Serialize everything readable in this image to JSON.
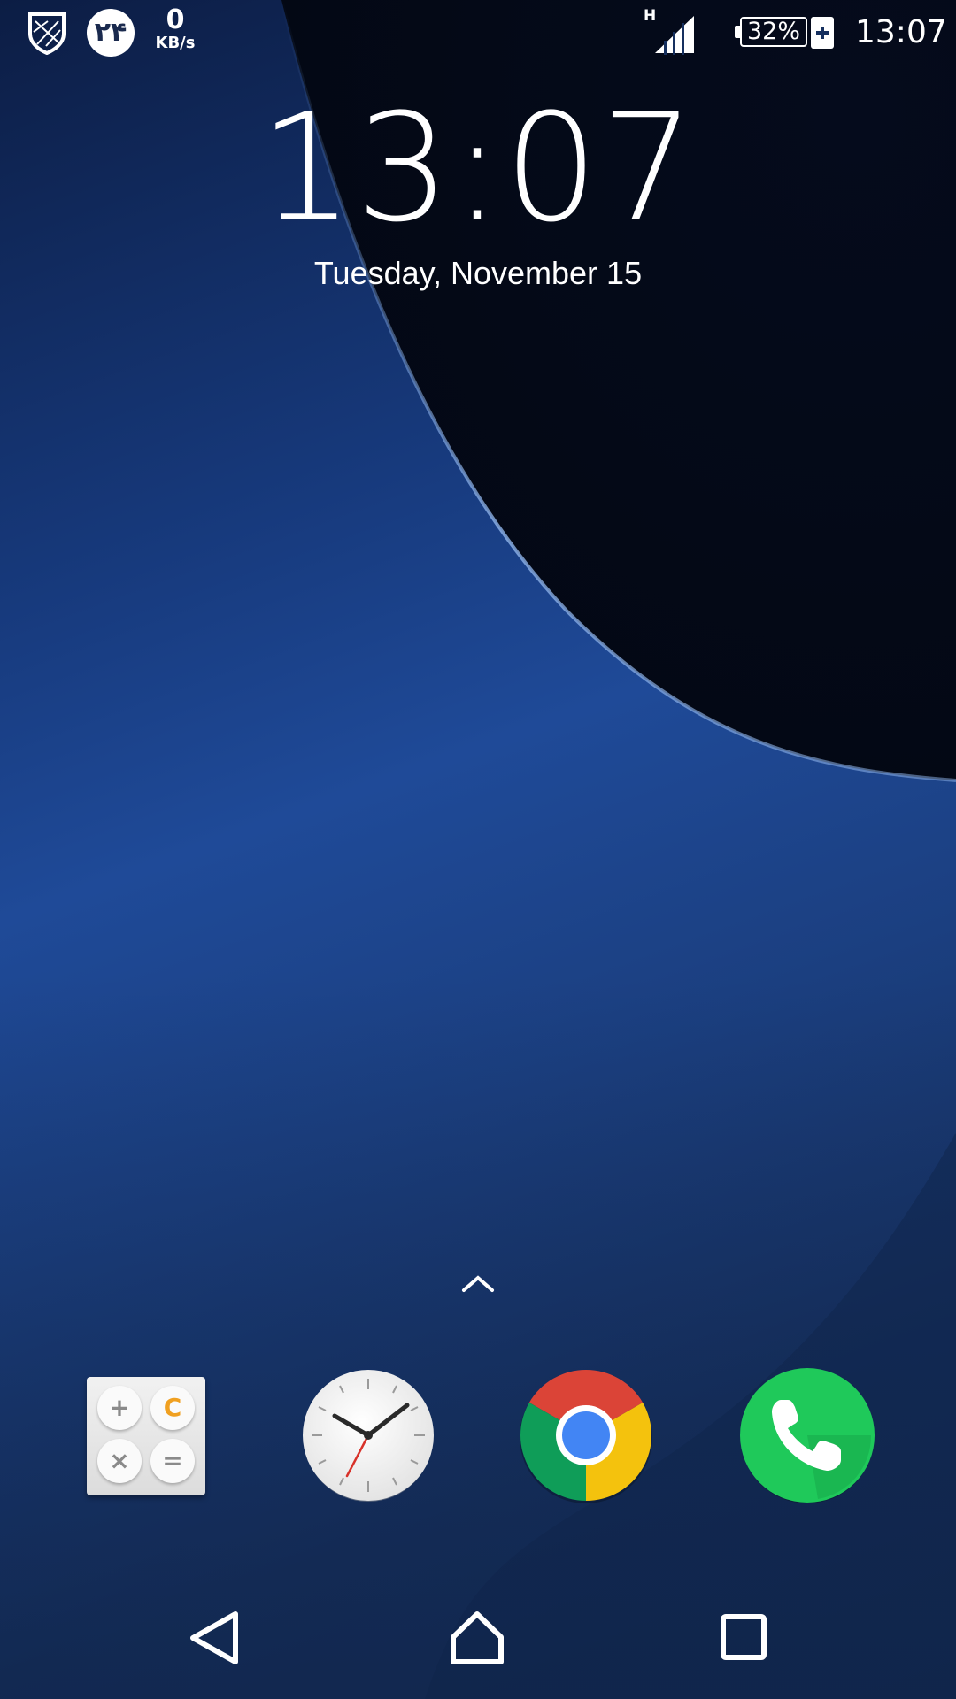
{
  "status_bar": {
    "calendar_badge": "۲۴",
    "net_speed_value": "0",
    "net_speed_unit": "KB/s",
    "network_type": "H",
    "battery_percent": "32%",
    "time": "13:07",
    "icons": [
      "shield-icon",
      "signal-icon",
      "battery-icon",
      "charging-icon"
    ]
  },
  "clock_widget": {
    "time": "13:07",
    "date": "Tuesday, November 15"
  },
  "dock": {
    "apps": [
      {
        "icon": "calculator-icon",
        "keys": [
          "+",
          "C",
          "×",
          "="
        ]
      },
      {
        "icon": "clock-icon"
      },
      {
        "icon": "chrome-icon"
      },
      {
        "icon": "phone-icon"
      }
    ]
  },
  "navigation": {
    "icons": [
      "back-icon",
      "home-icon",
      "recents-icon"
    ]
  },
  "colors": {
    "calculator_accent": "#f0a020",
    "phone_green": "#1fc95a",
    "chrome_red": "#db4437",
    "chrome_yellow": "#f4c20d",
    "chrome_green": "#0f9d58",
    "chrome_blue": "#4285f4"
  }
}
